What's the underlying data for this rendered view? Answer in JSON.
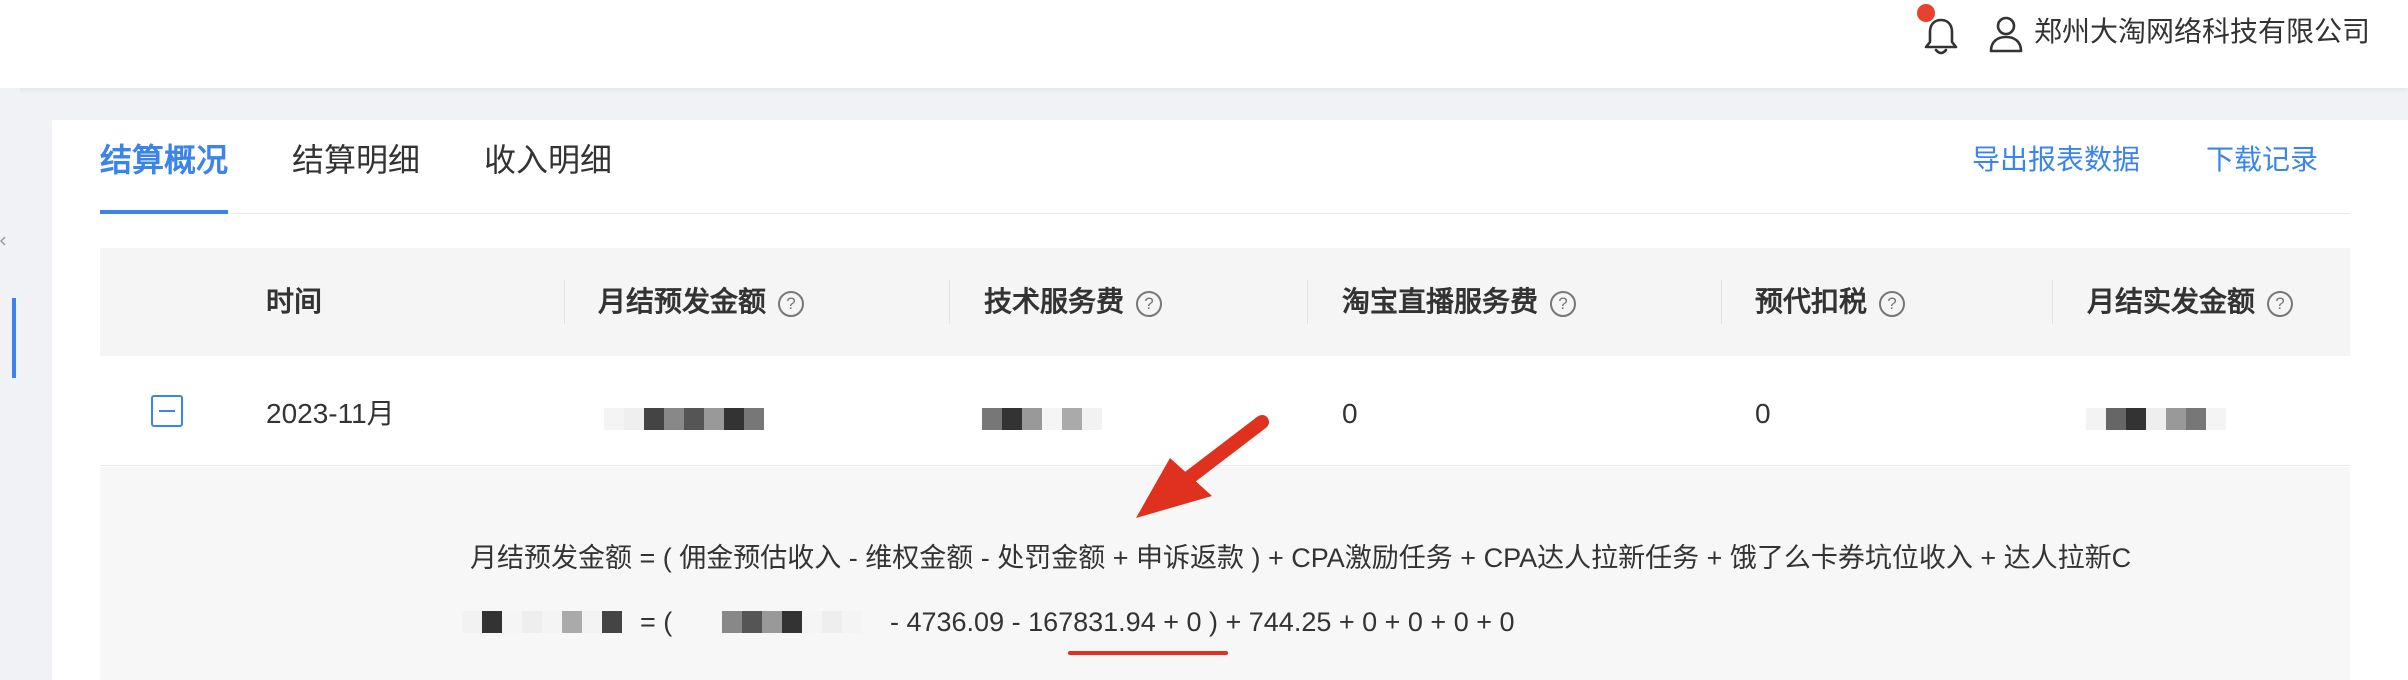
{
  "header": {
    "company": "郑州大淘网络科技有限公司",
    "icons": [
      "bell-icon",
      "user-icon"
    ],
    "notification_dot_color": "#e8412c"
  },
  "tabs": [
    {
      "label": "结算概况",
      "active": true
    },
    {
      "label": "结算明细",
      "active": false
    },
    {
      "label": "收入明细",
      "active": false
    }
  ],
  "actions": {
    "export": "导出报表数据",
    "download": "下载记录"
  },
  "table": {
    "columns": [
      "时间",
      "月结预发金额",
      "技术服务费",
      "淘宝直播服务费",
      "预代扣税",
      "月结实发金额"
    ],
    "help_mark": "?",
    "row": {
      "time": "2023-11月",
      "monthly_advance": "",
      "tech_fee": "",
      "live_fee": "0",
      "tax": "0",
      "monthly_actual": ""
    }
  },
  "detail": {
    "formula": "月结预发金额 = ( 佣金预估收入 - 维权金额 - 处罚金额 + 申诉返款 ) + CPA激励任务 + CPA达人拉新任务 + 饿了么卡券坑位收入 + 达人拉新C",
    "values_open": "= (",
    "values_minus": "-",
    "values_tail": "- 4736.09 - 167831.94 + 0 ) + 744.25 + 0 + 0 + 0 + 0",
    "highlighted_value": "167831.94"
  },
  "colors": {
    "accent": "#3a84ec",
    "annotation_red": "#e0301e"
  }
}
